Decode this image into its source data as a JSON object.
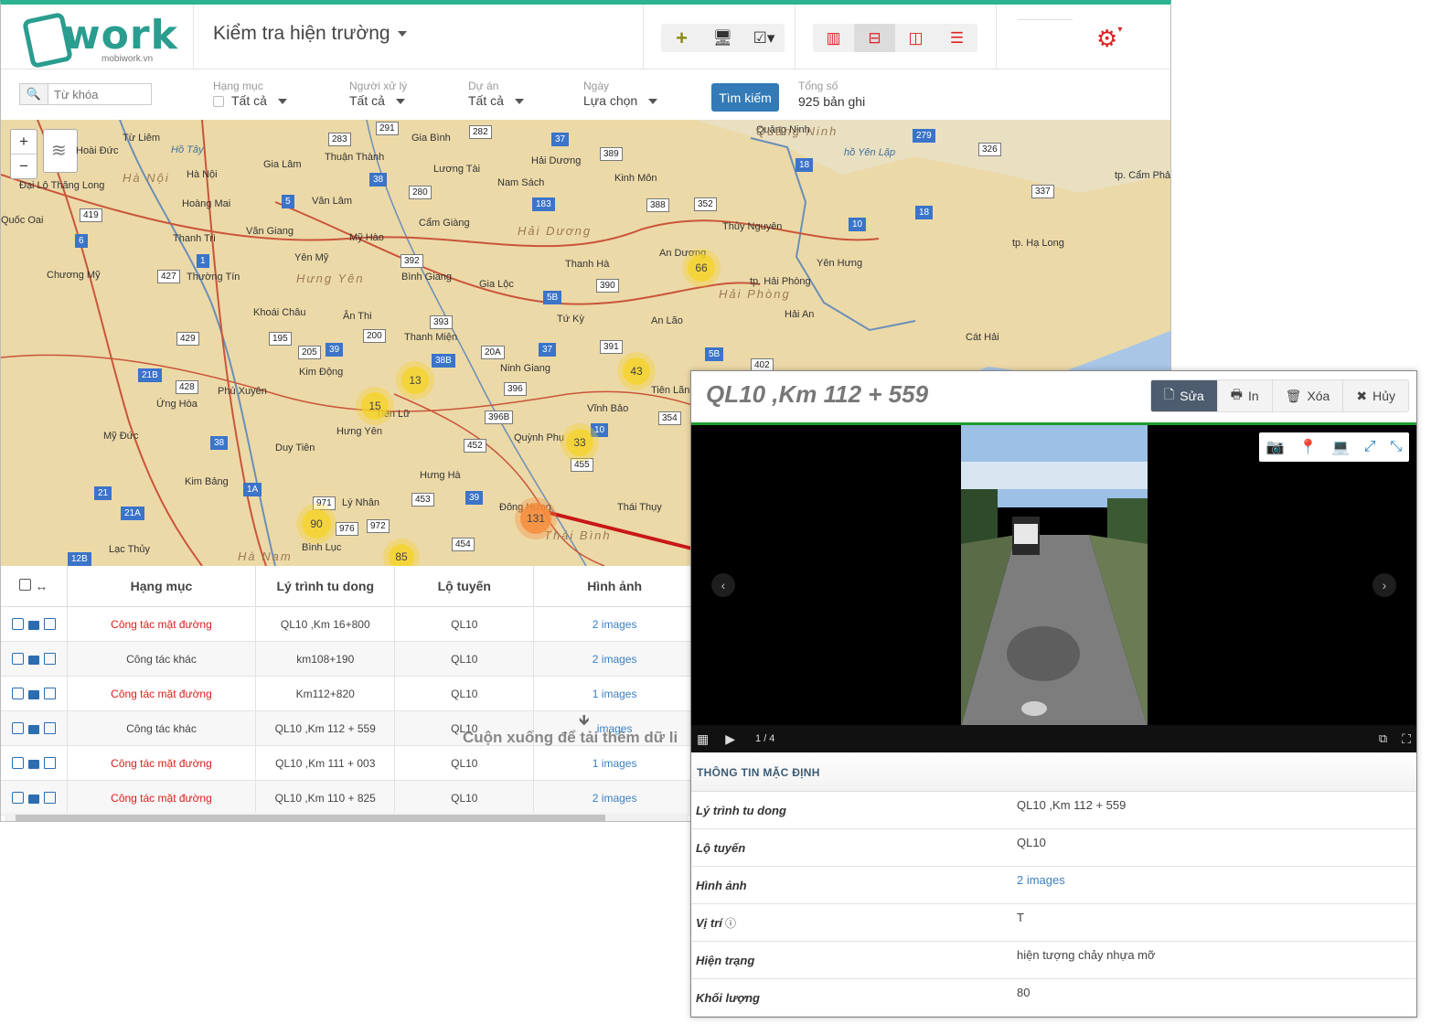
{
  "logo": {
    "text": "work",
    "sub": "mobiwork.vn"
  },
  "header": {
    "title": "Kiểm tra hiện trường"
  },
  "toolbar": {
    "add_icon": "plus-icon",
    "screen_icon": "monitor-icon",
    "check_icon": "checkbox-dropdown-icon",
    "views": [
      "map-view",
      "split-horizontal-view",
      "split-vertical-view",
      "list-view"
    ],
    "settings_icon": "gear-icon"
  },
  "filters": {
    "search_placeholder": "Từ khóa",
    "category": {
      "label": "Hạng mục",
      "value": "Tất cả"
    },
    "handler": {
      "label": "Người xử lý",
      "value": "Tất cả"
    },
    "project": {
      "label": "Dự án",
      "value": "Tất cả"
    },
    "date": {
      "label": "Ngày",
      "value": "Lựa chọn"
    },
    "search_button": "Tìm kiếm",
    "total_label": "Tổng số",
    "total_value": "925 bản ghi"
  },
  "map": {
    "zoom_in": "+",
    "zoom_out": "−",
    "places": [
      "Từ Liêm",
      "Hoài Đức",
      "Hà Nội",
      "Hồ Tây",
      "Hoàng Mai",
      "Đại Lộ Thăng Long",
      "Quốc Oai",
      "Thanh Trì",
      "Chương Mỹ",
      "Thường Tín",
      "Gia Lâm",
      "Văn Lâm",
      "Văn Giang",
      "Mỹ Hào",
      "Yên Mỹ",
      "Gia Bình",
      "Thuận Thành",
      "Lương Tài",
      "Hải Dương",
      "Nam Sách",
      "Kinh Môn",
      "Cẩm Giàng",
      "Bình Giang",
      "Gia Lộc",
      "Thanh Hà",
      "An Dương",
      "Thủy Nguyên",
      "Yên Hưng",
      "tp. Hải Phòng",
      "Hải An",
      "An Lão",
      "Tứ Kỳ",
      "Thanh Miện",
      "Ninh Giang",
      "Vĩnh Bảo",
      "Tiên Lãng",
      "Quỳnh Phụ",
      "Hưng Hà",
      "Đông Hưng",
      "Thái Thụy",
      "Khoái Châu",
      "Ân Thi",
      "Kim Động",
      "Phù Xuyên",
      "Ứng Hòa",
      "Mỹ Đức",
      "Duy Tiên",
      "Kim Bảng",
      "Lý Nhân",
      "Bình Lục",
      "Lạc Thủy",
      "Hưng Yên",
      "Tiên Lữ",
      "Quảng Ninh",
      "tp. Hạ Long",
      "tp. Cẩm Phả",
      "Cát Hải",
      "hồ Yên Lập"
    ],
    "regions": [
      "Hà Nội",
      "Hải Dương",
      "Hưng Yên",
      "Hải Phòng",
      "Thái Bình",
      "Hà Nam",
      "Quảng Ninh"
    ],
    "roads": [
      "283",
      "291",
      "282",
      "389",
      "37",
      "18",
      "279",
      "326",
      "337",
      "18",
      "10",
      "5",
      "38",
      "280",
      "183",
      "388",
      "352",
      "419",
      "6",
      "1",
      "427",
      "392",
      "390",
      "5B",
      "393",
      "200",
      "205",
      "39",
      "195",
      "429",
      "38B",
      "20A",
      "37",
      "391",
      "402",
      "5B",
      "21B",
      "428",
      "396",
      "396B",
      "354",
      "10",
      "452",
      "455",
      "38",
      "453",
      "39",
      "971",
      "976",
      "972",
      "21",
      "1A",
      "21A",
      "454",
      "12B"
    ],
    "clusters": [
      {
        "count": "66",
        "color": "yellow"
      },
      {
        "count": "13",
        "color": "yellow"
      },
      {
        "count": "15",
        "color": "yellow"
      },
      {
        "count": "43",
        "color": "yellow"
      },
      {
        "count": "33",
        "color": "yellow"
      },
      {
        "count": "90",
        "color": "yellow"
      },
      {
        "count": "85",
        "color": "yellow"
      },
      {
        "count": "131",
        "color": "orange"
      }
    ]
  },
  "grid": {
    "columns": [
      "Hạng mục",
      "Lý trình tu dong",
      "Lộ tuyến",
      "Hình ảnh"
    ],
    "rows": [
      {
        "category": "Công tác mặt đường",
        "station": "QL10 ,Km 16+800",
        "route": "QL10",
        "images": "2 images",
        "highlight": true
      },
      {
        "category": "Công tác khác",
        "station": "km108+190",
        "route": "QL10",
        "images": "2 images",
        "highlight": false
      },
      {
        "category": "Công tác mặt đường",
        "station": "Km112+820",
        "route": "QL10",
        "images": "1 images",
        "highlight": true
      },
      {
        "category": "Công tác khác",
        "station": "QL10 ,Km 112 + 559",
        "route": "QL10",
        "images": "images",
        "highlight": false
      },
      {
        "category": "Công tác mặt đường",
        "station": "QL10 ,Km 111 + 003",
        "route": "QL10",
        "images": "1 images",
        "highlight": true
      },
      {
        "category": "Công tác mặt đường",
        "station": "QL10 ,Km 110 + 825",
        "route": "QL10",
        "images": "2 images",
        "highlight": true
      }
    ],
    "loading_message": "Cuộn xuống để tải thêm dữ li"
  },
  "detail": {
    "title": "QL10 ,Km 112 + 559",
    "buttons": {
      "edit": "Sửa",
      "print": "In",
      "delete": "Xóa",
      "cancel": "Hủy"
    },
    "viewer": {
      "counter": "1 / 4"
    },
    "section": "THÔNG TIN MẶC ĐỊNH",
    "fields": [
      {
        "label": "Lý trình tu dong",
        "value": "QL10 ,Km 112 + 559"
      },
      {
        "label": "Lộ tuyến",
        "value": "QL10"
      },
      {
        "label": "Hình ảnh",
        "value": "2 images"
      },
      {
        "label": "Vị trí",
        "value": "T"
      },
      {
        "label": "Hiện trạng",
        "value": "hiện tượng chảy nhựa mỡ"
      },
      {
        "label": "Khối lượng",
        "value": "80"
      }
    ]
  }
}
